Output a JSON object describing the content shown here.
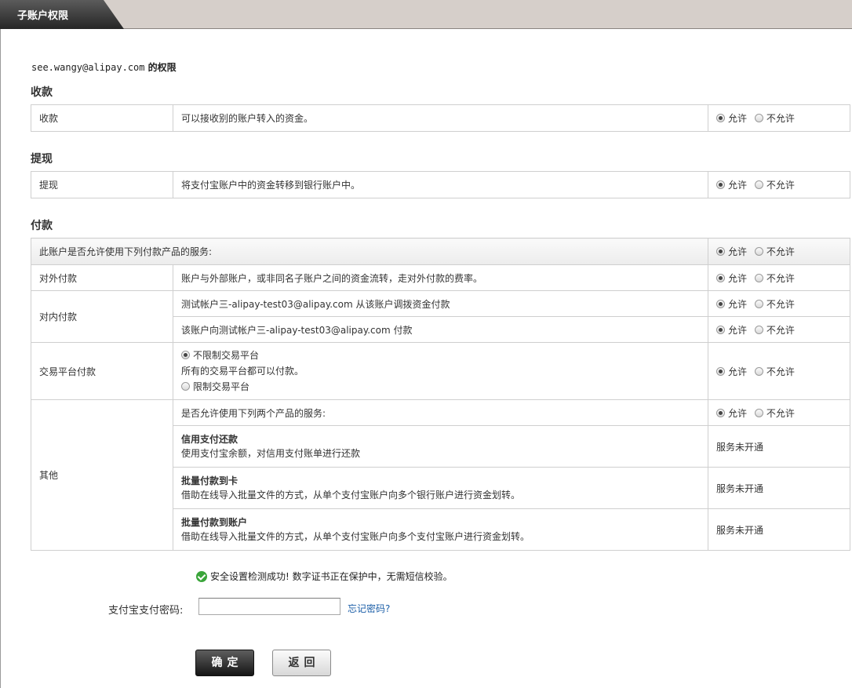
{
  "tab_title": "子账户权限",
  "account": {
    "email": "see.wangy@alipay.com",
    "suffix": " 的权限"
  },
  "allow_label": "允许",
  "deny_label": "不允许",
  "sections": {
    "receive": {
      "title": "收款",
      "row": {
        "name": "收款",
        "desc": "可以接收别的账户转入的资金。"
      }
    },
    "withdraw": {
      "title": "提现",
      "row": {
        "name": "提现",
        "desc": "将支付宝账户中的资金转移到银行账户中。"
      }
    },
    "pay": {
      "title": "付款",
      "header": "此账户是否允许使用下列付款产品的服务:",
      "external": {
        "name": "对外付款",
        "desc": "账户与外部账户，或非同名子账户之间的资金流转，走对外付款的费率。"
      },
      "internal": {
        "name": "对内付款",
        "row1": "测试帐户三-alipay-test03@alipay.com 从该账户调拨资金付款",
        "row2": "该账户向测试帐户三-alipay-test03@alipay.com 付款"
      },
      "trade": {
        "name": "交易平台付款",
        "opt_unlimited": "不限制交易平台",
        "opt_unlimited_desc": "所有的交易平台都可以付款。",
        "opt_limited": "限制交易平台"
      },
      "other": {
        "name": "其他",
        "header": "是否允许使用下列两个产品的服务:",
        "items": [
          {
            "title": "信用支付还款",
            "desc": "使用支付宝余额，对信用支付账单进行还款",
            "status": "服务未开通"
          },
          {
            "title": "批量付款到卡",
            "desc": "借助在线导入批量文件的方式，从单个支付宝账户向多个银行账户进行资金划转。",
            "status": "服务未开通"
          },
          {
            "title": "批量付款到账户",
            "desc": "借助在线导入批量文件的方式，从单个支付宝账户向多个支付宝账户进行资金划转。",
            "status": "服务未开通"
          }
        ]
      }
    }
  },
  "notice": "安全设置检测成功! 数字证书正在保护中，无需短信校验。",
  "password": {
    "label": "支付宝支付密码:",
    "value": "",
    "forgot": "忘记密码?"
  },
  "buttons": {
    "confirm": "确定",
    "back": "返回"
  },
  "colors": {
    "tab_bg": "#262626",
    "topbar_bg": "#d6cfca",
    "link": "#1c5fa8",
    "ok_green": "#3aa53a"
  }
}
